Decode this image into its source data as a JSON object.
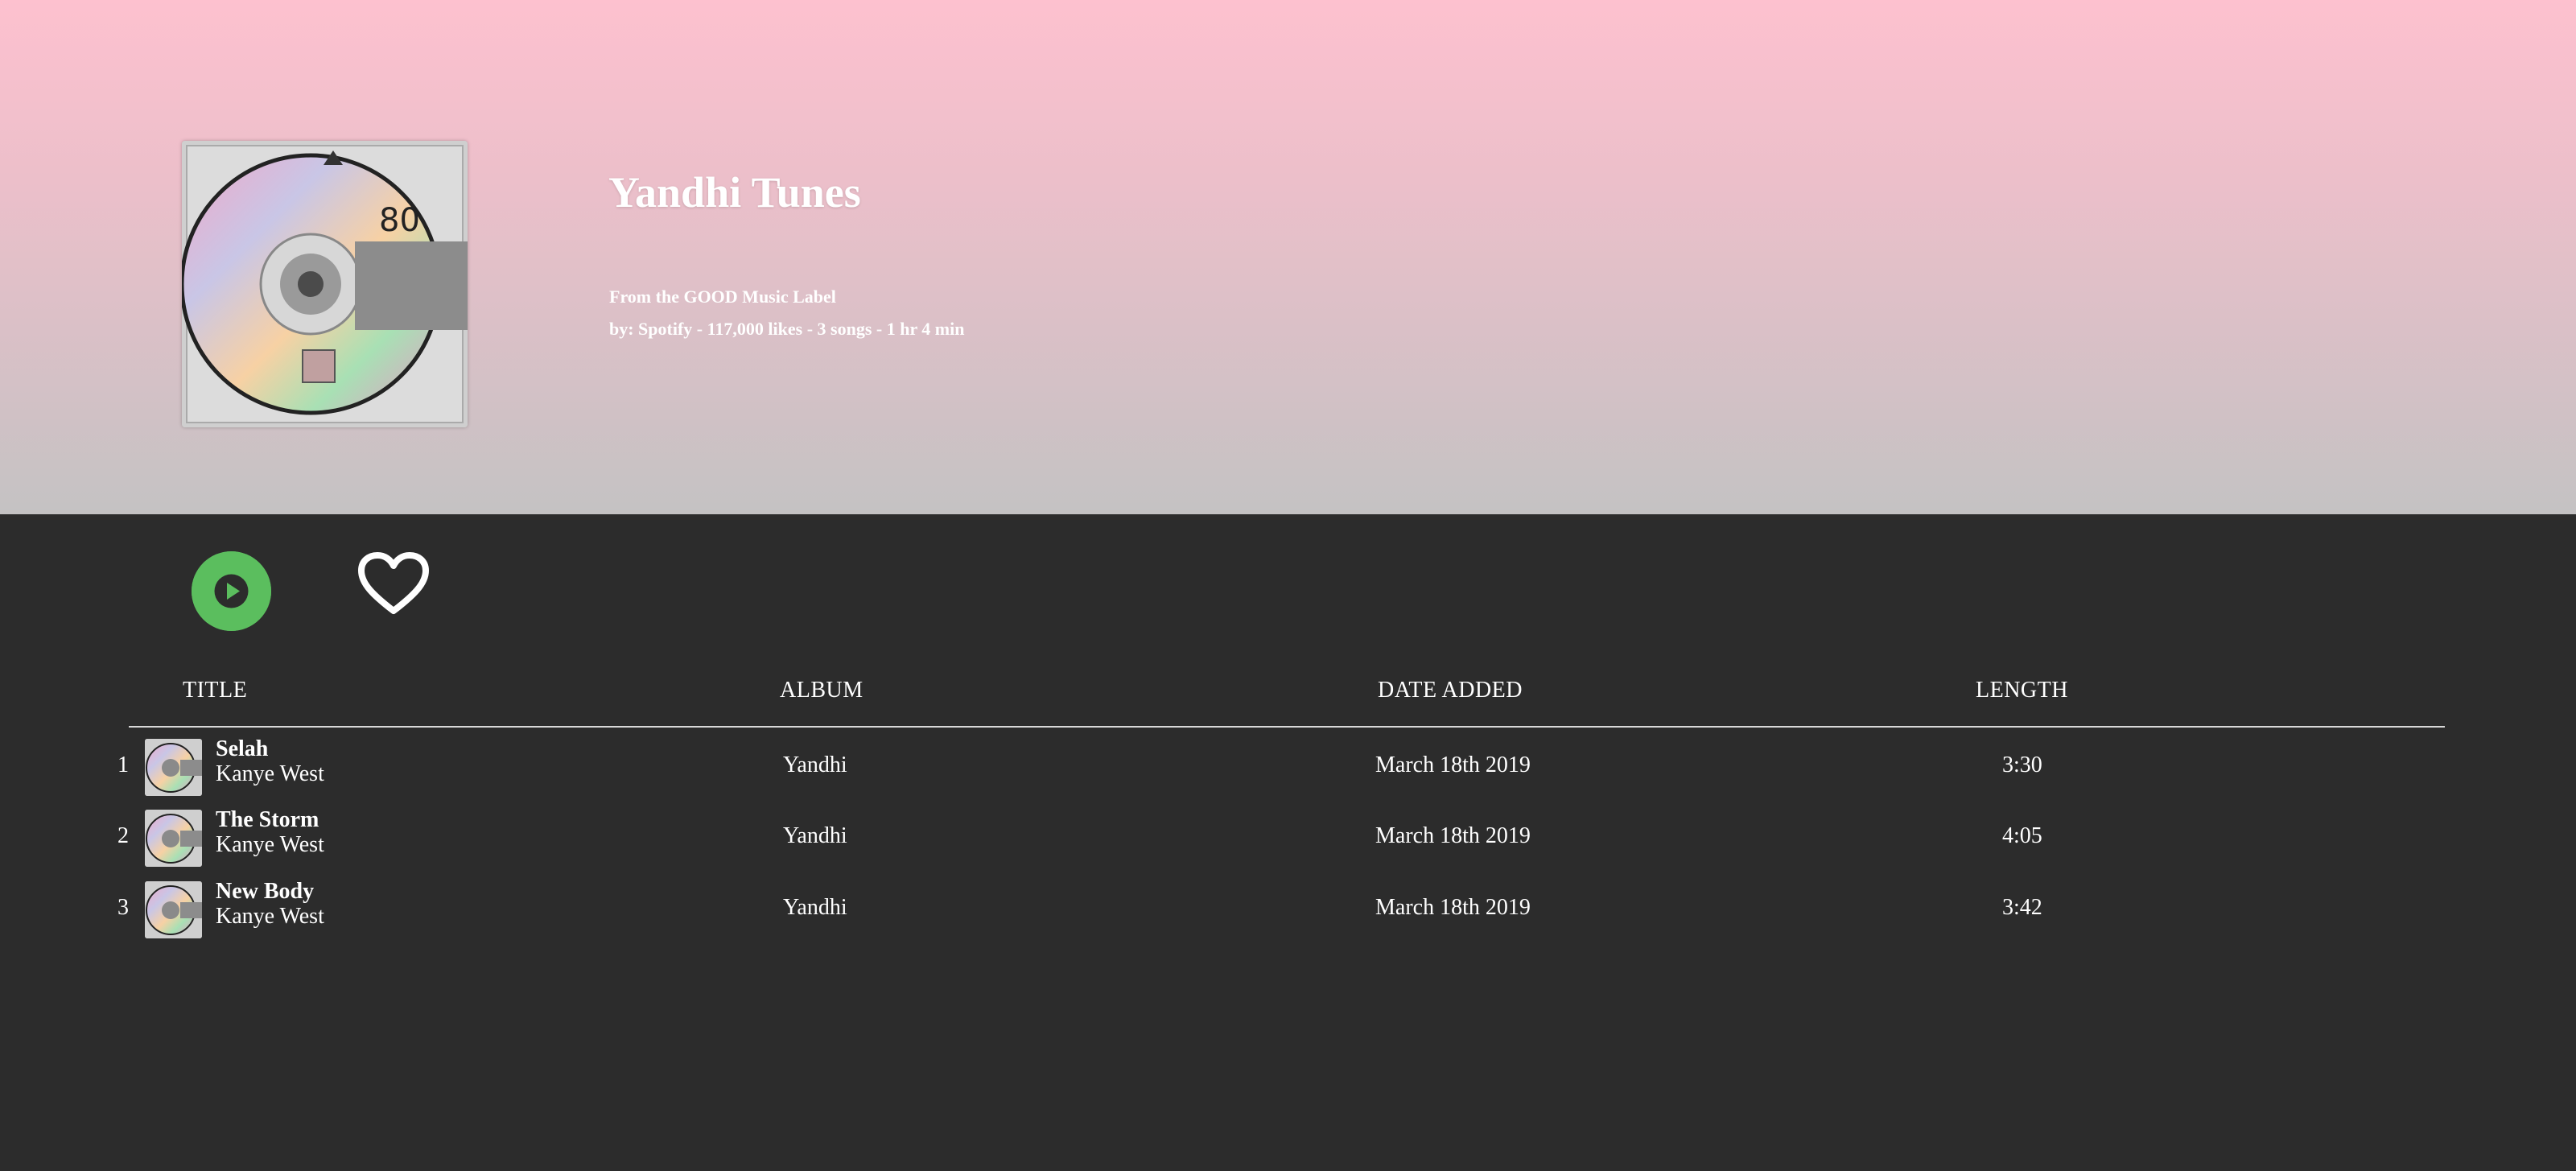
{
  "playlist": {
    "title": "Yandhi Tunes",
    "label_line": "From the GOOD Music Label",
    "meta_line": "by: Spotify - 117,000 likes - 3 songs - 1 hr 4 min",
    "cover_text": "80"
  },
  "controls": {
    "play_icon": "play-icon",
    "like_icon": "heart-icon",
    "play_color": "#5bbe5e"
  },
  "columns": {
    "title": "TITLE",
    "album": "ALBUM",
    "date": "DATE ADDED",
    "length": "LENGTH"
  },
  "tracks": [
    {
      "num": "1",
      "title": "Selah",
      "artist": "Kanye West",
      "album": "Yandhi",
      "date": "March 18th 2019",
      "length": "3:30"
    },
    {
      "num": "2",
      "title": "The Storm",
      "artist": "Kanye West",
      "album": "Yandhi",
      "date": "March 18th 2019",
      "length": "4:05"
    },
    {
      "num": "3",
      "title": "New Body",
      "artist": "Kanye West",
      "album": "Yandhi",
      "date": "March 18th 2019",
      "length": "3:42"
    }
  ],
  "colors": {
    "hero_top": "#fdc1cf",
    "hero_bottom": "#c4c2c3",
    "background": "#2c2c2c"
  }
}
